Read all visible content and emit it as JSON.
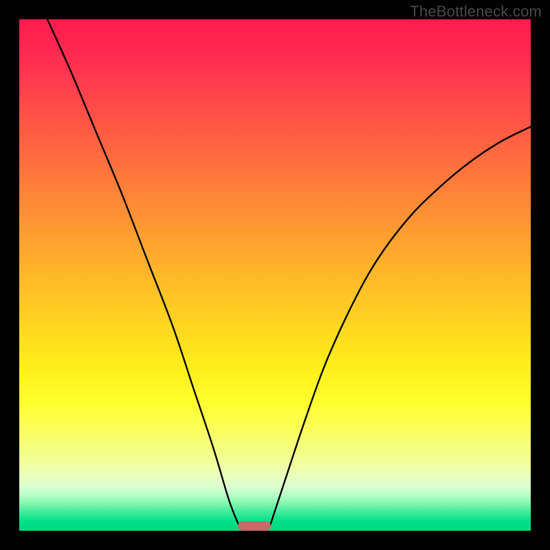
{
  "watermark": "TheBottleneck.com",
  "chart_data": {
    "type": "line",
    "title": "",
    "xlabel": "",
    "ylabel": "",
    "xlim": [
      0,
      100
    ],
    "ylim": [
      0,
      100
    ],
    "grid": false,
    "background": {
      "type": "vertical-gradient",
      "stops": [
        {
          "pos": 0,
          "color": "#ff1a4d"
        },
        {
          "pos": 50,
          "color": "#ffbe27"
        },
        {
          "pos": 75,
          "color": "#ffff2e"
        },
        {
          "pos": 90,
          "color": "#e8ffc0"
        },
        {
          "pos": 100,
          "color": "#00d97e"
        }
      ]
    },
    "series": [
      {
        "name": "left-curve",
        "color": "#000000",
        "points": [
          {
            "x": 5.5,
            "y": 100
          },
          {
            "x": 10,
            "y": 90
          },
          {
            "x": 15,
            "y": 78
          },
          {
            "x": 20,
            "y": 66
          },
          {
            "x": 25,
            "y": 53
          },
          {
            "x": 30,
            "y": 40
          },
          {
            "x": 34,
            "y": 28
          },
          {
            "x": 38,
            "y": 16
          },
          {
            "x": 41,
            "y": 6
          },
          {
            "x": 43,
            "y": 0.9
          }
        ]
      },
      {
        "name": "right-curve",
        "color": "#000000",
        "points": [
          {
            "x": 49,
            "y": 0.9
          },
          {
            "x": 52,
            "y": 10
          },
          {
            "x": 56,
            "y": 22
          },
          {
            "x": 60,
            "y": 33
          },
          {
            "x": 65,
            "y": 44
          },
          {
            "x": 70,
            "y": 53
          },
          {
            "x": 76,
            "y": 61
          },
          {
            "x": 82,
            "y": 67
          },
          {
            "x": 88,
            "y": 72
          },
          {
            "x": 94,
            "y": 76
          },
          {
            "x": 100,
            "y": 79
          }
        ]
      }
    ],
    "marker": {
      "name": "bottleneck-marker",
      "color": "#c76a6a",
      "x_center": 46,
      "x_width": 6.5,
      "y": 0.9
    }
  }
}
